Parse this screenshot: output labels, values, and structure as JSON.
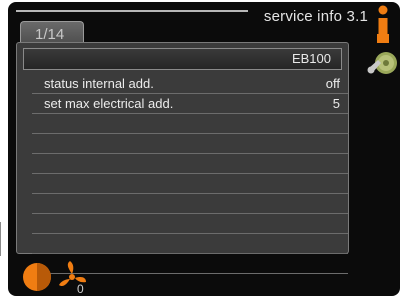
{
  "header": {
    "title": "service info 3.1"
  },
  "tab": {
    "label": "1/14"
  },
  "panel": {
    "section_label": "EB100",
    "rows": [
      {
        "label": "status internal add.",
        "value": "off"
      },
      {
        "label": "set max electrical add.",
        "value": "5"
      },
      {
        "label": "",
        "value": ""
      },
      {
        "label": "",
        "value": ""
      },
      {
        "label": "",
        "value": ""
      },
      {
        "label": "",
        "value": ""
      },
      {
        "label": "",
        "value": ""
      },
      {
        "label": "",
        "value": ""
      },
      {
        "label": "",
        "value": ""
      },
      {
        "label": "",
        "value": ""
      }
    ]
  },
  "footer": {
    "fan_speed": "0"
  },
  "icons": {
    "info": "info-icon",
    "service": "service-tools-icon",
    "heating": "heating-icon",
    "fan": "fan-icon"
  },
  "colors": {
    "accent_orange": "#f07d12",
    "background": "#0b0b0b",
    "panel": "#3b3b3b",
    "text": "#ececec"
  }
}
